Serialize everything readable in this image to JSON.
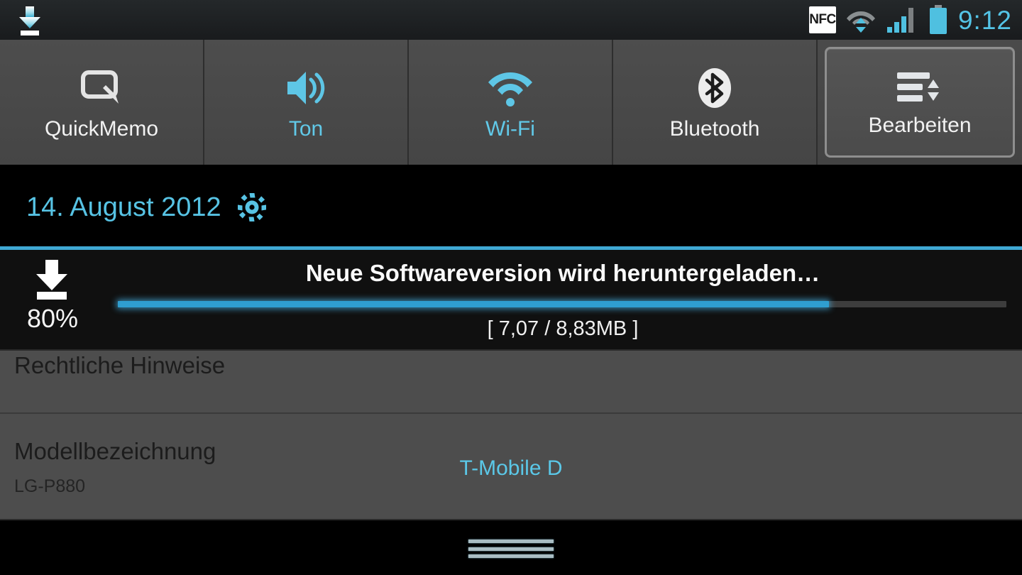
{
  "status_bar": {
    "download_icon": "download-arrow-icon",
    "nfc_label": "NFC",
    "wifi_icon": "wifi-transfer-icon",
    "signal_icon": "signal-bars-icon",
    "battery_icon": "battery-full-icon",
    "clock": "9:12",
    "accent": "#54c4e6"
  },
  "toggles": [
    {
      "label": "QuickMemo",
      "icon": "quickmemo-icon",
      "active": false
    },
    {
      "label": "Ton",
      "icon": "sound-speaker-icon",
      "active": true
    },
    {
      "label": "Wi-Fi",
      "icon": "wifi-icon",
      "active": true
    },
    {
      "label": "Bluetooth",
      "icon": "bluetooth-icon",
      "active": false
    }
  ],
  "edit_button": {
    "label": "Bearbeiten",
    "icon": "reorder-sort-icon"
  },
  "date_row": {
    "date": "14. August 2012",
    "settings_icon": "gear-icon",
    "accent": "#57c3e4"
  },
  "notification": {
    "icon": "download-arrow-icon",
    "percent_label": "80%",
    "percent_value": 80,
    "title": "Neue Softwareversion wird heruntergeladen…",
    "subtitle": "[ 7,07 / 8,83MB ]",
    "progress_color": "#2f9ed0"
  },
  "settings_list": [
    {
      "title": "Rechtliche Hinweise",
      "subtitle": "",
      "value": ""
    },
    {
      "title": "Modellbezeichnung",
      "subtitle": "LG-P880",
      "value": "T-Mobile D"
    }
  ],
  "drag_handle": {
    "icon": "drag-handle-icon"
  }
}
